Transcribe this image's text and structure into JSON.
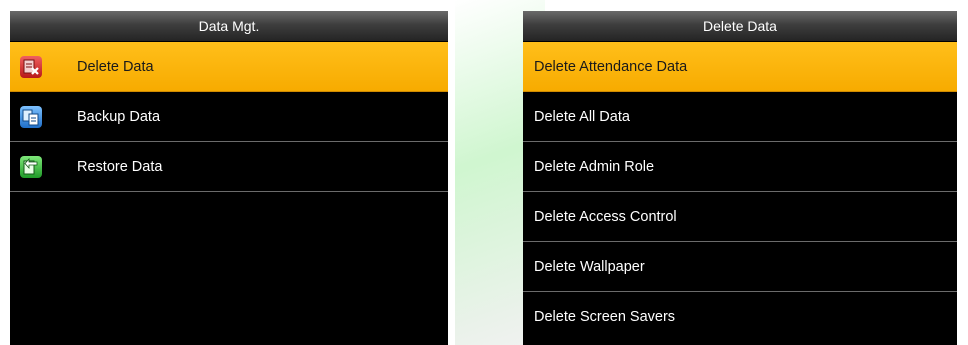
{
  "left_menu": {
    "title": "Data Mgt.",
    "items": [
      {
        "label": "Delete Data",
        "icon": "delete-data-icon",
        "selected": true
      },
      {
        "label": "Backup Data",
        "icon": "backup-data-icon",
        "selected": false
      },
      {
        "label": "Restore Data",
        "icon": "restore-data-icon",
        "selected": false
      }
    ]
  },
  "right_menu": {
    "title": "Delete Data",
    "items": [
      {
        "label": "Delete Attendance Data",
        "selected": true
      },
      {
        "label": "Delete All Data",
        "selected": false
      },
      {
        "label": "Delete Admin Role",
        "selected": false
      },
      {
        "label": "Delete Access Control",
        "selected": false
      },
      {
        "label": "Delete Wallpaper",
        "selected": false
      },
      {
        "label": "Delete Screen Savers",
        "selected": false
      }
    ]
  },
  "colors": {
    "highlight": "#f7ab00",
    "background": "#000000",
    "text": "#ffffff"
  }
}
